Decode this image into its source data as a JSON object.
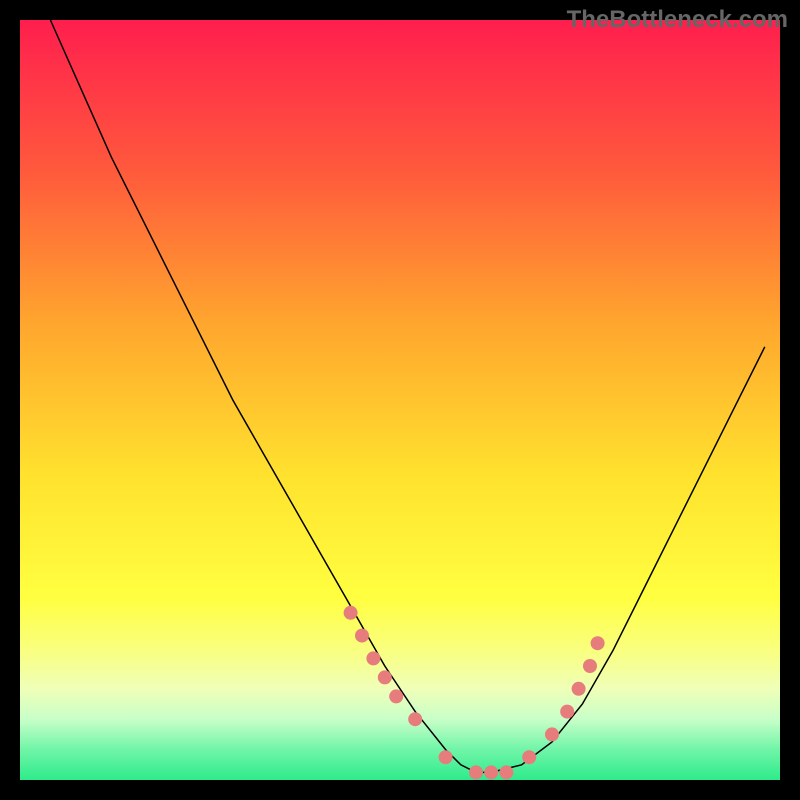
{
  "watermark": "TheBottleneck.com",
  "chart_data": {
    "type": "line",
    "title": "",
    "xlabel": "",
    "ylabel": "",
    "xlim": [
      0,
      100
    ],
    "ylim": [
      0,
      100
    ],
    "grid": false,
    "legend": false,
    "series": [
      {
        "name": "curve",
        "color": "#000000",
        "x": [
          4,
          8,
          12,
          16,
          20,
          24,
          28,
          32,
          36,
          40,
          44,
          48,
          52,
          56,
          58,
          60,
          62,
          66,
          70,
          74,
          78,
          82,
          86,
          90,
          94,
          98
        ],
        "y": [
          100,
          91,
          82,
          74,
          66,
          58,
          50,
          43,
          36,
          29,
          22,
          15,
          9,
          4,
          2,
          1,
          1,
          2,
          5,
          10,
          17,
          25,
          33,
          41,
          49,
          57
        ]
      }
    ],
    "markers": [
      {
        "name": "dots",
        "color": "#E77C7C",
        "radius": 7,
        "x": [
          43.5,
          45,
          46.5,
          48,
          49.5,
          52,
          56,
          60,
          62,
          64,
          67,
          70,
          72,
          73.5,
          75,
          76
        ],
        "y": [
          22,
          19,
          16,
          13.5,
          11,
          8,
          3,
          1,
          1,
          1,
          3,
          6,
          9,
          12,
          15,
          18
        ]
      }
    ],
    "gradient_stops": [
      {
        "offset": 0.0,
        "color": "#FF1E4E"
      },
      {
        "offset": 0.2,
        "color": "#FF5A3C"
      },
      {
        "offset": 0.4,
        "color": "#FFA62E"
      },
      {
        "offset": 0.6,
        "color": "#FFE22E"
      },
      {
        "offset": 0.76,
        "color": "#FFFF40"
      },
      {
        "offset": 0.83,
        "color": "#F9FF80"
      },
      {
        "offset": 0.88,
        "color": "#EFFFB8"
      },
      {
        "offset": 0.92,
        "color": "#C8FFC8"
      },
      {
        "offset": 0.96,
        "color": "#70F5A8"
      },
      {
        "offset": 1.0,
        "color": "#2EEB8C"
      }
    ]
  }
}
